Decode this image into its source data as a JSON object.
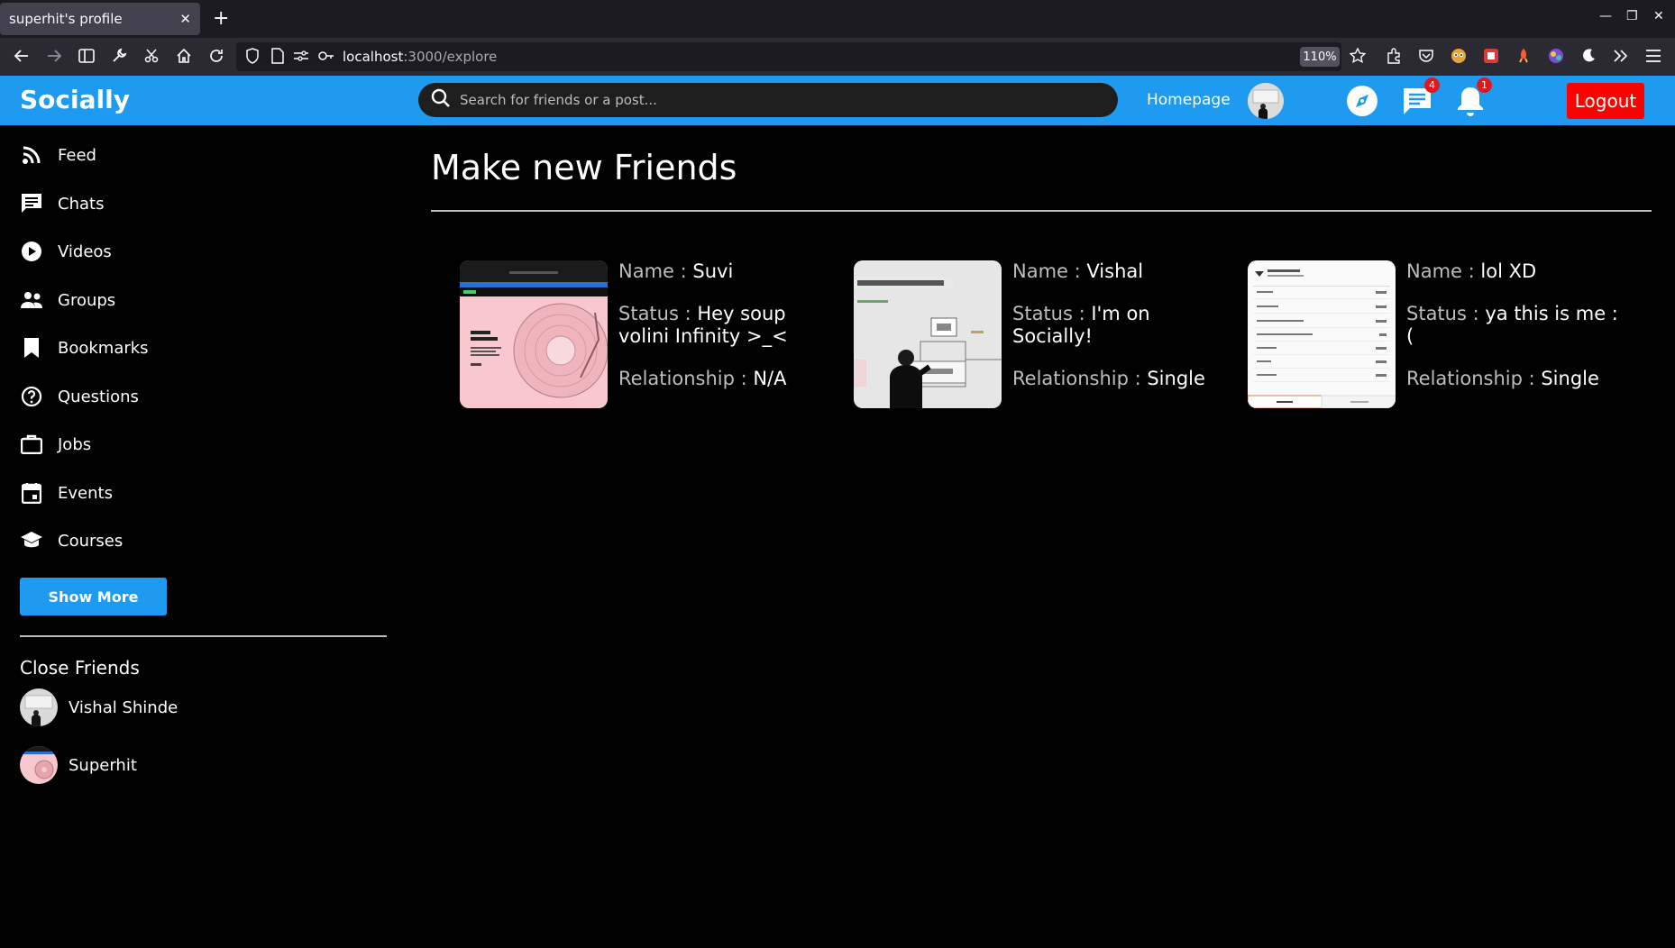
{
  "browser": {
    "tab_title": "superhit's profile",
    "tab_close": "✕",
    "new_tab": "+",
    "url_host": "localhost",
    "url_path": ":3000/explore",
    "zoom": "110%",
    "window_controls": [
      "—",
      "❐",
      "✕"
    ]
  },
  "header": {
    "logo": "Socially",
    "search_placeholder": "Search for friends or a post...",
    "homepage_label": "Homepage",
    "chat_badge": "4",
    "notification_badge": "1",
    "logout_label": "Logout"
  },
  "sidebar": {
    "items": [
      {
        "label": "Feed",
        "icon": "rss-feed-icon"
      },
      {
        "label": "Chats",
        "icon": "chat-icon"
      },
      {
        "label": "Videos",
        "icon": "play-circle-icon"
      },
      {
        "label": "Groups",
        "icon": "group-icon"
      },
      {
        "label": "Bookmarks",
        "icon": "bookmark-icon"
      },
      {
        "label": "Questions",
        "icon": "help-circle-icon"
      },
      {
        "label": "Jobs",
        "icon": "briefcase-icon"
      },
      {
        "label": "Events",
        "icon": "calendar-icon"
      },
      {
        "label": "Courses",
        "icon": "school-icon"
      }
    ],
    "show_more_label": "Show More",
    "close_friends_title": "Close Friends",
    "close_friends": [
      {
        "name": "Vishal Shinde"
      },
      {
        "name": "Superhit"
      }
    ]
  },
  "main": {
    "title": "Make new Friends",
    "labels": {
      "name": "Name : ",
      "status": "Status : ",
      "relationship": "Relationship : "
    },
    "cards": [
      {
        "name": "Suvi",
        "status": "Hey soup volini Infinity >_<",
        "relationship": "N/A"
      },
      {
        "name": "Vishal",
        "status": "I'm on Socially!",
        "relationship": "Single"
      },
      {
        "name": "lol XD",
        "status": "ya this is me :(",
        "relationship": "Single"
      }
    ]
  },
  "colors": {
    "brand": "#1e9bf0",
    "logout": "#ff0000",
    "badge": "#e0181e",
    "background": "#000000"
  }
}
